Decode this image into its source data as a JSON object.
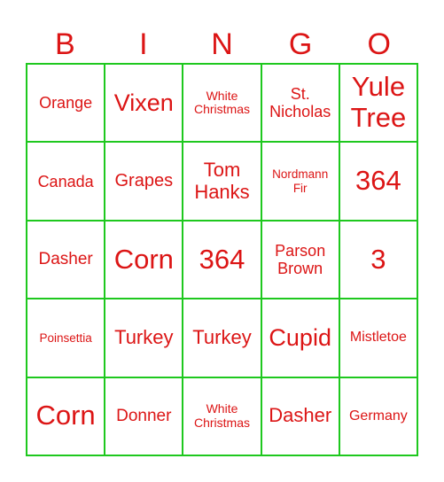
{
  "header": [
    "B",
    "I",
    "N",
    "G",
    "O"
  ],
  "colors": {
    "text": "#dc1515",
    "grid": "#1ec81e",
    "background": "#ffffff"
  },
  "cells": [
    {
      "text": "Orange",
      "size": "s18"
    },
    {
      "text": "Vixen",
      "size": "s27"
    },
    {
      "text": "White Christmas",
      "size": "s14"
    },
    {
      "text": "St. Nicholas",
      "size": "s18"
    },
    {
      "text": "Yule Tree",
      "size": "s30"
    },
    {
      "text": "Canada",
      "size": "s18"
    },
    {
      "text": "Grapes",
      "size": "s20"
    },
    {
      "text": "Tom Hanks",
      "size": "s22"
    },
    {
      "text": "Nordmann Fir",
      "size": "s13"
    },
    {
      "text": "364",
      "size": "s30"
    },
    {
      "text": "Dasher",
      "size": "s19"
    },
    {
      "text": "Corn",
      "size": "s30"
    },
    {
      "text": "364",
      "size": "s30"
    },
    {
      "text": "Parson Brown",
      "size": "s18"
    },
    {
      "text": "3",
      "size": "s30"
    },
    {
      "text": "Poinsettia",
      "size": "s13"
    },
    {
      "text": "Turkey",
      "size": "s22"
    },
    {
      "text": "Turkey",
      "size": "s22"
    },
    {
      "text": "Cupid",
      "size": "s27"
    },
    {
      "text": "Mistletoe",
      "size": "s16"
    },
    {
      "text": "Corn",
      "size": "s30"
    },
    {
      "text": "Donner",
      "size": "s19"
    },
    {
      "text": "White Christmas",
      "size": "s14"
    },
    {
      "text": "Dasher",
      "size": "s22"
    },
    {
      "text": "Germany",
      "size": "s16"
    }
  ]
}
